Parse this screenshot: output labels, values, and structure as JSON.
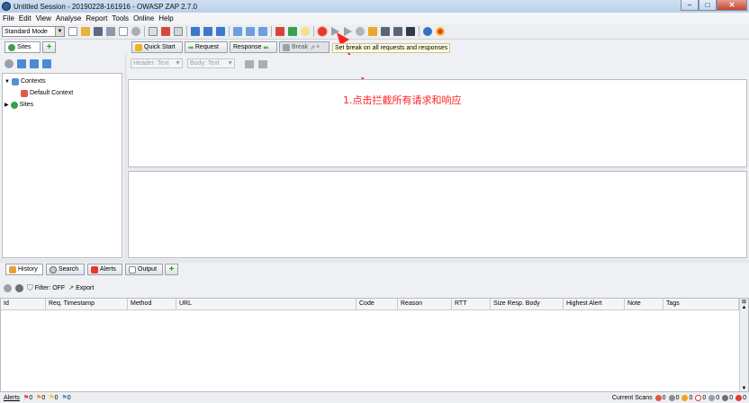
{
  "window": {
    "title": "Untitled Session - 20190228-161916 - OWASP ZAP 2.7.0",
    "minimize": "–",
    "maximize": "□",
    "close": "✕"
  },
  "menu": [
    "File",
    "Edit",
    "View",
    "Analyse",
    "Report",
    "Tools",
    "Online",
    "Help"
  ],
  "toolbar": {
    "mode_value": "Standard Mode",
    "tooltip": "Set break on all requests and responses"
  },
  "left_tabs": {
    "sites": "Sites",
    "add": "+"
  },
  "tree": {
    "contexts": "Contexts",
    "default_context": "Default Context",
    "sites": "Sites"
  },
  "main_tabs": {
    "quick_start": "Quick Start",
    "request": "Request",
    "response": "Response",
    "break": "Break"
  },
  "break_toolbar": {
    "header_view": "Header: Text",
    "body_view": "Body: Text"
  },
  "annotation": "1.点击拦截所有请求和响应",
  "bottom_tabs": {
    "history": "History",
    "search": "Search",
    "alerts": "Alerts",
    "output": "Output",
    "add": "+"
  },
  "history_toolbar": {
    "filter": "Filter: OFF",
    "export": "Export"
  },
  "columns": [
    "Id",
    "Req. Timestamp",
    "Method",
    "URL",
    "Code",
    "Reason",
    "RTT",
    "Size Resp. Body",
    "Highest Alert",
    "Note",
    "Tags"
  ],
  "status": {
    "alerts_label": "Alerts",
    "alert_counts": [
      "0",
      "0",
      "0",
      "0"
    ],
    "current_scans_label": "Current Scans",
    "scan_counts": [
      "0",
      "0",
      "0",
      "0",
      "0",
      "0",
      "0"
    ],
    "colors": {
      "high": "#e53a2a",
      "medium": "#f28a1d",
      "low": "#f2c51d",
      "info": "#4a8fd8"
    }
  }
}
